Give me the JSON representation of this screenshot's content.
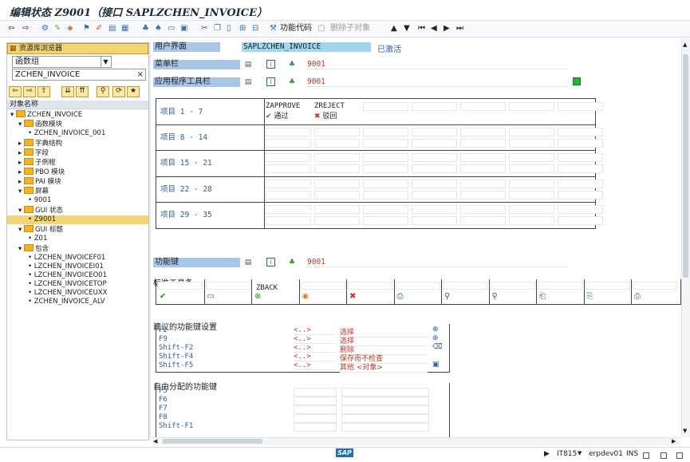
{
  "window": {
    "title": "编辑状态 Z9001（接口 SAPLZCHEN_INVOICE）"
  },
  "toolbar": {
    "func_code_label": "功能代码",
    "delete_sub_label": "删除子对象"
  },
  "tree": {
    "header": "资源库浏览器",
    "type_value": "函数组",
    "name_value": "ZCHEN_INVOICE",
    "column_header": "对象名称",
    "nodes": [
      {
        "label": "ZCHEN_INVOICE"
      },
      {
        "label": "函数模块"
      },
      {
        "label": "ZCHEN_INVOICE_001"
      },
      {
        "label": "字典结构"
      },
      {
        "label": "字段"
      },
      {
        "label": "子例程"
      },
      {
        "label": "PBO 模块"
      },
      {
        "label": "PAI 模块"
      },
      {
        "label": "屏幕"
      },
      {
        "label": "9001"
      },
      {
        "label": "GUI 状态"
      },
      {
        "label": "Z9001"
      },
      {
        "label": "GUI 标题"
      },
      {
        "label": "Z01"
      },
      {
        "label": "包含"
      },
      {
        "label": "LZCHEN_INVOICEF01"
      },
      {
        "label": "LZCHEN_INVOICEI01"
      },
      {
        "label": "LZCHEN_INVOICEO01"
      },
      {
        "label": "LZCHEN_INVOICETOP"
      },
      {
        "label": "LZCHEN_INVOICEUXX"
      },
      {
        "label": "ZCHEN_INVOICE_ALV"
      }
    ]
  },
  "main": {
    "user_interface_label": "用户界面",
    "user_interface_value": "SAPLZCHEN_INVOICE",
    "status": "已激活",
    "menubar_label": "菜单栏",
    "menubar_value": "9001",
    "app_toolbar_label": "应用程序工具栏",
    "app_toolbar_value": "9001",
    "item_rows": [
      "项目  1 -  7",
      "项目  8 - 14",
      "项目 15 - 21",
      "项目 22 - 28",
      "项目 29 - 35"
    ],
    "app_items": [
      {
        "code": "ZAPPROVE",
        "text": "通过"
      },
      {
        "code": "ZREJECT",
        "text": "驳回"
      }
    ],
    "function_keys_label": "功能键",
    "function_keys_value": "9001",
    "std_toolbar_label": "标准工具条",
    "std_toolbar_code": "ZBACK",
    "recommended_label": "建议的功能键设置",
    "recommended": [
      {
        "key": "F2",
        "code": "<..>",
        "text": "选择"
      },
      {
        "key": "F9",
        "code": "<..>",
        "text": "选择"
      },
      {
        "key": "Shift-F2",
        "code": "<..>",
        "text": "删除"
      },
      {
        "key": "Shift-F4",
        "code": "<..>",
        "text": "保存而不检查"
      },
      {
        "key": "Shift-F5",
        "code": "<..>",
        "text": "其他 <对象>"
      }
    ],
    "free_label": "自由分配的功能键",
    "free_keys": [
      "F5",
      "F6",
      "F7",
      "F8",
      "Shift-F1"
    ]
  },
  "statusbar": {
    "logo": "SAP",
    "tcode": "IT815",
    "server": "erpdev01",
    "mode": "INS"
  }
}
